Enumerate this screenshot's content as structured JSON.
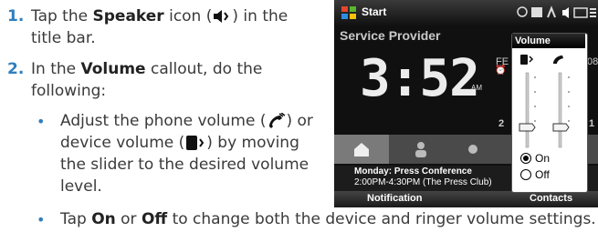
{
  "steps": [
    {
      "number": "1.",
      "line1_pre": "Tap the ",
      "line1_bold": "Speaker",
      "line1_post": " icon (",
      "line1_end": ") in the",
      "line2": "title bar."
    },
    {
      "number": "2.",
      "line1_pre": "In the ",
      "line1_bold": "Volume",
      "line1_post": " callout, do the",
      "line2": "following:"
    }
  ],
  "substeps": [
    {
      "l1_pre": "Adjust the phone volume (",
      "l1_post": ") or",
      "l2_pre": "device volume (",
      "l2_post": ") by moving",
      "l3": "the slider to the desired volume",
      "l4": "level."
    },
    {
      "pre": "Tap ",
      "b1": "On",
      "mid1": " or ",
      "b2": "Off",
      "post": " to change both the device and ringer volume settings."
    }
  ],
  "phone": {
    "start_label": "Start",
    "service_provider": "Service Provider",
    "clock": "3:52",
    "am": "AM",
    "volume_title": "Volume",
    "radio_on": "On",
    "radio_off": "Off",
    "meeting_title": "Monday: Press Conference",
    "meeting_time": "2:00PM-4:30PM (The Press Club)",
    "softkey_left": "Notification",
    "softkey_right": "Contacts",
    "side_chars": [
      "FE",
      "08",
      "2",
      "1"
    ]
  },
  "icons": [
    "speaker-icon",
    "phone-icon",
    "device-speaker-icon"
  ]
}
